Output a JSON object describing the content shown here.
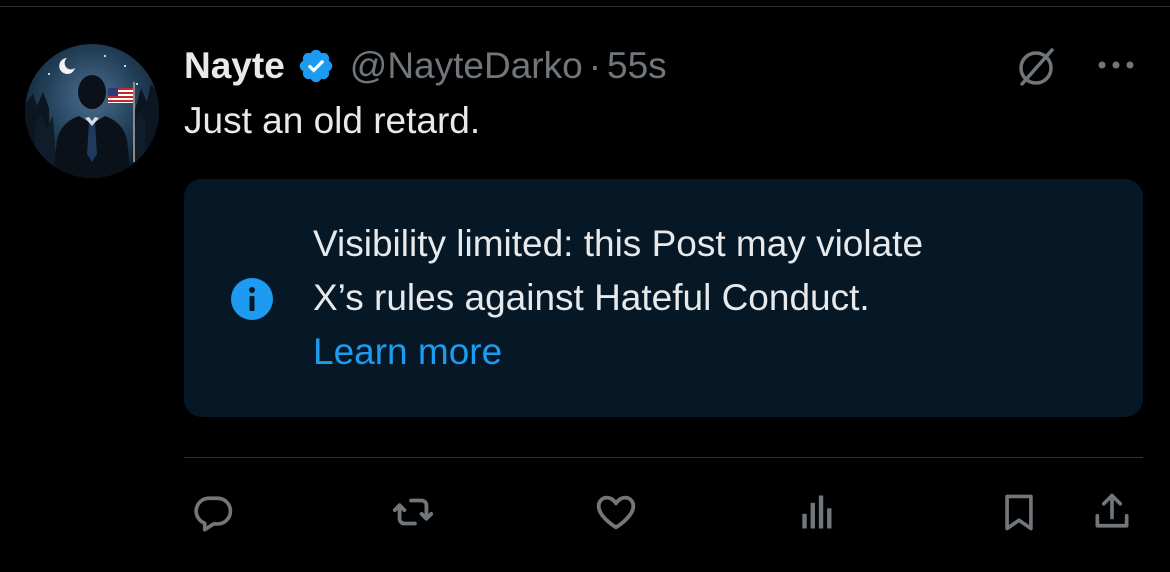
{
  "post": {
    "author": {
      "display_name": "Nayte",
      "handle": "@NayteDarko",
      "separator": "·",
      "timestamp": "55s",
      "verified": true,
      "avatar_description": "silhouette of man in suit with moon, trees and US flag"
    },
    "text": "Just an old retard.",
    "notice": {
      "line1": "Visibility limited: this Post may violate",
      "line2": "X’s rules against Hateful Conduct.",
      "link": "Learn more",
      "icon": "info-icon"
    },
    "actions": [
      {
        "name": "reply",
        "icon": "reply-icon"
      },
      {
        "name": "repost",
        "icon": "repost-icon"
      },
      {
        "name": "like",
        "icon": "heart-icon"
      },
      {
        "name": "views",
        "icon": "analytics-icon"
      },
      {
        "name": "bookmark",
        "icon": "bookmark-icon"
      },
      {
        "name": "share",
        "icon": "share-icon"
      }
    ]
  },
  "colors": {
    "background": "#000000",
    "text_primary": "#e7e9ea",
    "text_secondary": "#71767b",
    "accent": "#1d9bf0",
    "notice_bg": "#061826",
    "divider": "#2f3336"
  }
}
